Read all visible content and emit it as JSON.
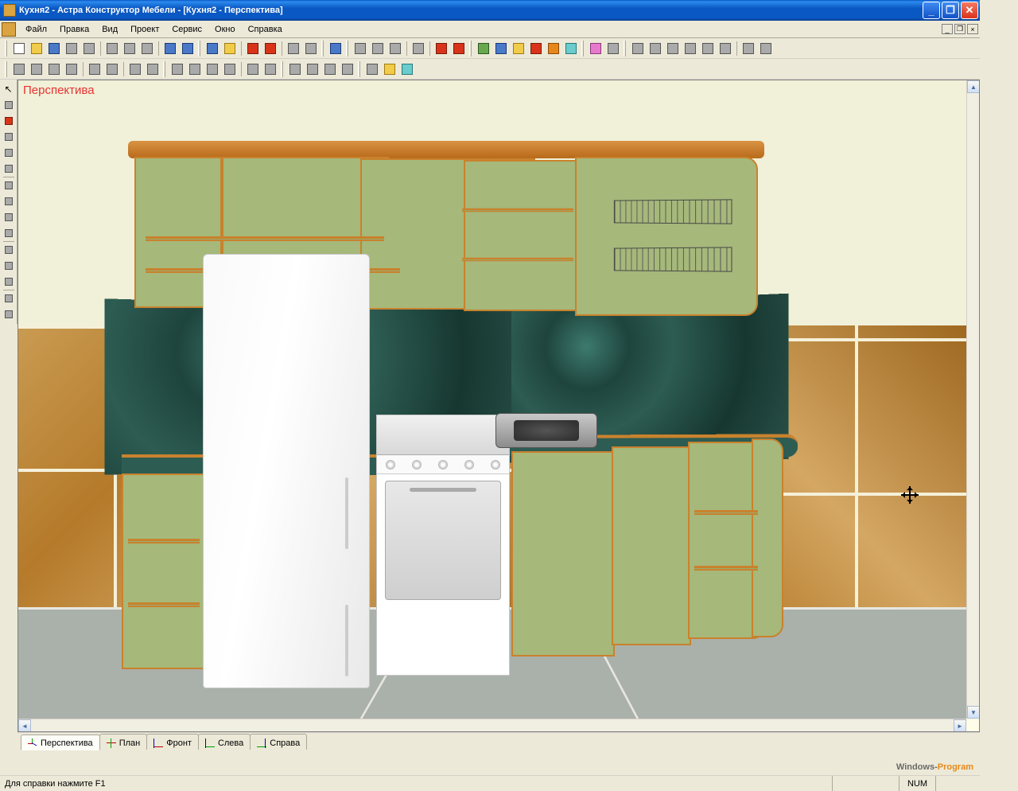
{
  "titlebar": {
    "text": "Кухня2 - Астра Конструктор Мебели - [Кухня2 - Перспектива]"
  },
  "menu": {
    "file": "Файл",
    "edit": "Правка",
    "view": "Вид",
    "project": "Проект",
    "service": "Сервис",
    "window": "Окно",
    "help": "Справка"
  },
  "viewport": {
    "label": "Перспектива"
  },
  "tabs": {
    "perspective": "Перспектива",
    "plan": "План",
    "front": "Фронт",
    "left": "Слева",
    "right": "Справа"
  },
  "watermark": {
    "a": "Windows-",
    "b": "Program"
  },
  "statusbar": {
    "help": "Для справки нажмите F1",
    "num": "NUM"
  }
}
